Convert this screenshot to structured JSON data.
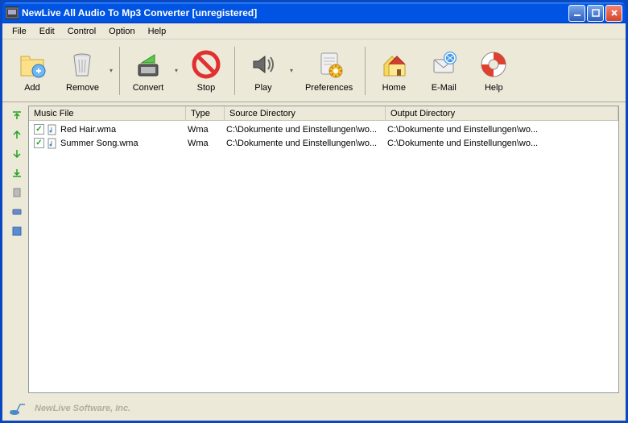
{
  "window": {
    "title": "NewLive All Audio To Mp3 Converter  [unregistered]"
  },
  "menu": {
    "items": [
      "File",
      "Edit",
      "Control",
      "Option",
      "Help"
    ]
  },
  "toolbar": {
    "add": "Add",
    "remove": "Remove",
    "convert": "Convert",
    "stop": "Stop",
    "play": "Play",
    "preferences": "Preferences",
    "home": "Home",
    "email": "E-Mail",
    "help": "Help"
  },
  "columns": {
    "file": "Music File",
    "type": "Type",
    "src": "Source Directory",
    "out": "Output Directory"
  },
  "rows": [
    {
      "checked": true,
      "name": "Red Hair.wma",
      "type": "Wma",
      "src": "C:\\Dokumente und Einstellungen\\wo...",
      "out": "C:\\Dokumente und Einstellungen\\wo..."
    },
    {
      "checked": true,
      "name": "Summer Song.wma",
      "type": "Wma",
      "src": "C:\\Dokumente und Einstellungen\\wo...",
      "out": "C:\\Dokumente und Einstellungen\\wo..."
    }
  ],
  "status": {
    "company": "NewLive Software, Inc."
  },
  "colors": {
    "titlebar": "#0054e3",
    "chrome": "#ece9d8",
    "accent_green": "#21a121"
  }
}
